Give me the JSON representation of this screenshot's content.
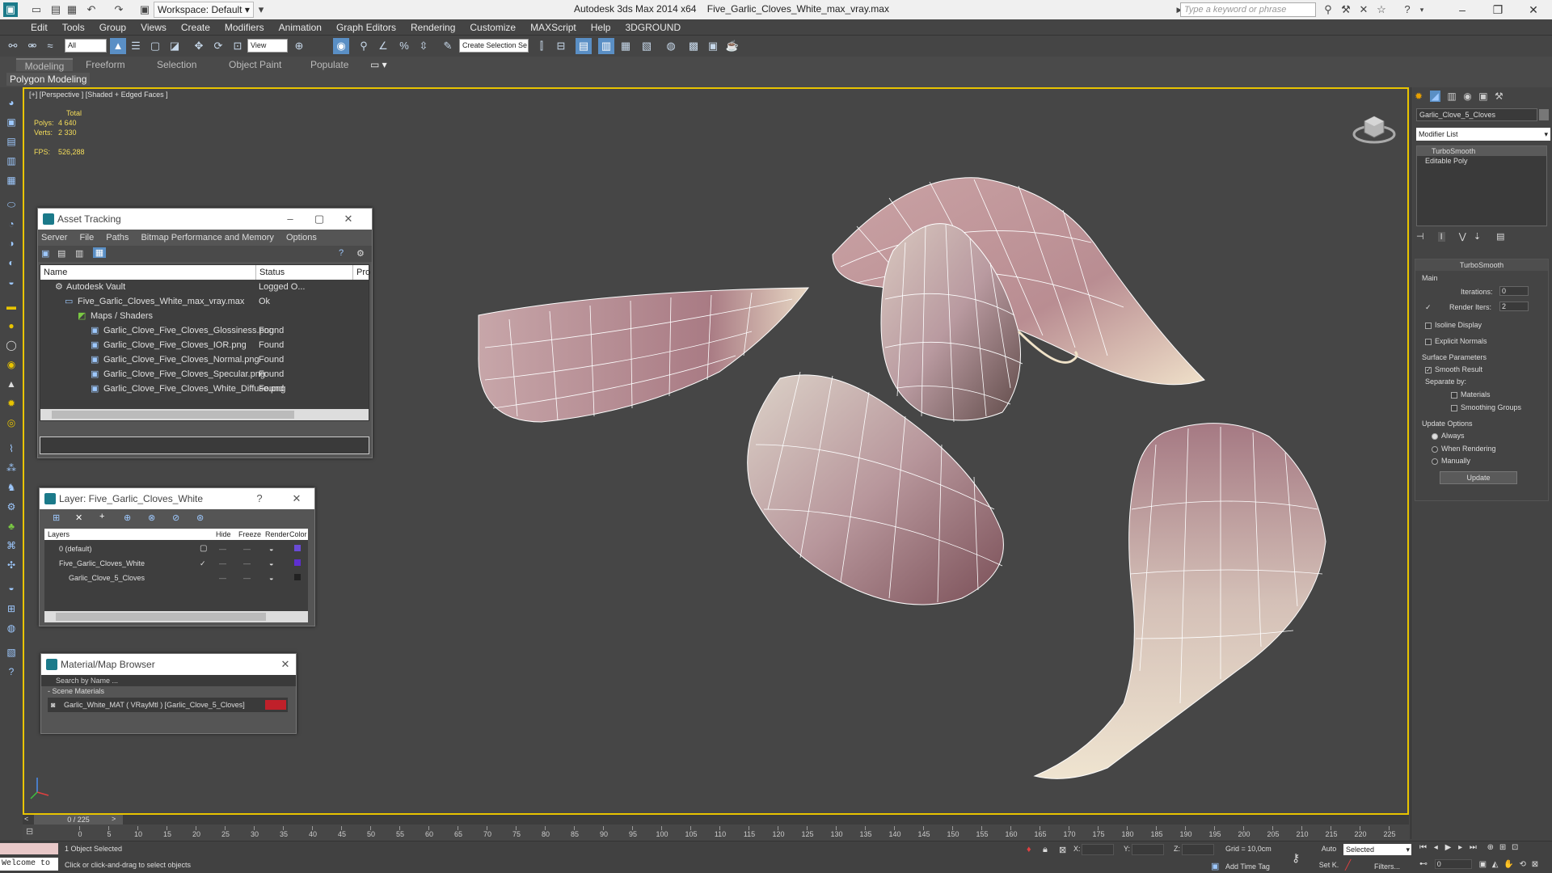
{
  "app": {
    "title": "Autodesk 3ds Max  2014 x64",
    "file": "Five_Garlic_Cloves_White_max_vray.max",
    "workspace": "Workspace: Default",
    "search_placeholder": "Type a keyword or phrase"
  },
  "menu": [
    "Edit",
    "Tools",
    "Group",
    "Views",
    "Create",
    "Modifiers",
    "Animation",
    "Graph Editors",
    "Rendering",
    "Customize",
    "MAXScript",
    "Help",
    "3DGROUND"
  ],
  "toolbar": {
    "filter": "All",
    "coord": "View",
    "named_selection": "Create Selection Se"
  },
  "ribbon": {
    "tabs": [
      "Modeling",
      "Freeform",
      "Selection",
      "Object Paint",
      "Populate"
    ],
    "subtab": "Polygon Modeling"
  },
  "viewport": {
    "label": "[+] [Perspective ] [Shaded + Edged Faces ]",
    "stats": {
      "total_label": "Total",
      "polys_label": "Polys:",
      "polys": "4 640",
      "verts_label": "Verts:",
      "verts": "2 330",
      "fps_label": "FPS:",
      "fps": "526,288"
    }
  },
  "asset_tracking": {
    "title": "Asset Tracking",
    "menu": [
      "Server",
      "File",
      "Paths",
      "Bitmap Performance and Memory",
      "Options"
    ],
    "columns": [
      "Name",
      "Status",
      "Pro"
    ],
    "rows": [
      {
        "name": "Autodesk Vault",
        "status": "Logged O..."
      },
      {
        "name": "Five_Garlic_Cloves_White_max_vray.max",
        "status": "Ok"
      },
      {
        "name": "Maps / Shaders",
        "status": ""
      },
      {
        "name": "Garlic_Clove_Five_Cloves_Glossiness.png",
        "status": "Found"
      },
      {
        "name": "Garlic_Clove_Five_Cloves_IOR.png",
        "status": "Found"
      },
      {
        "name": "Garlic_Clove_Five_Cloves_Normal.png",
        "status": "Found"
      },
      {
        "name": "Garlic_Clove_Five_Cloves_Specular.png",
        "status": "Found"
      },
      {
        "name": "Garlic_Clove_Five_Cloves_White_Diffuse.png",
        "status": "Found"
      }
    ]
  },
  "layer_window": {
    "title": "Layer: Five_Garlic_Cloves_White",
    "columns": [
      "Layers",
      "Hide",
      "Freeze",
      "Render",
      "Color"
    ],
    "rows": [
      {
        "name": "0 (default)",
        "color": "#6a4bd6"
      },
      {
        "name": "Five_Garlic_Cloves_White",
        "color": "#5e2fd0"
      },
      {
        "name": "Garlic_Clove_5_Cloves",
        "color": "#222222"
      }
    ]
  },
  "material_browser": {
    "title": "Material/Map Browser",
    "search_placeholder": "Search by Name ...",
    "section": "Scene Materials",
    "item": "Garlic_White_MAT ( VRayMtl ) [Garlic_Clove_5_Cloves]"
  },
  "command_panel": {
    "object_name": "Garlic_Clove_5_Cloves",
    "modifier_list": "Modifier List",
    "stack": [
      "TurboSmooth",
      "Editable Poly"
    ],
    "rollout_title": "TurboSmooth",
    "main_label": "Main",
    "iterations_label": "Iterations:",
    "iterations": "0",
    "render_iters_label": "Render Iters:",
    "render_iters": "2",
    "isoline": "Isoline Display",
    "explicit_normals": "Explicit Normals",
    "surface_params": "Surface Parameters",
    "smooth_result": "Smooth Result",
    "separate_by": "Separate by:",
    "materials": "Materials",
    "smoothing_groups": "Smoothing Groups",
    "update_options": "Update Options",
    "always": "Always",
    "when_rendering": "When Rendering",
    "manually": "Manually",
    "update_button": "Update"
  },
  "timeline": {
    "frame": "0 / 225",
    "ticks": [
      "0",
      "5",
      "10",
      "15",
      "20",
      "25",
      "30",
      "35",
      "40",
      "45",
      "50",
      "55",
      "60",
      "65",
      "70",
      "75",
      "80",
      "85",
      "90",
      "95",
      "100",
      "105",
      "110",
      "115",
      "120",
      "125",
      "130",
      "135",
      "140",
      "145",
      "150",
      "155",
      "160",
      "165",
      "170",
      "175",
      "180",
      "185",
      "190",
      "195",
      "200",
      "205",
      "210",
      "215",
      "220",
      "225"
    ]
  },
  "status": {
    "welcome": "Welcome to",
    "selected": "1 Object Selected",
    "hint": "Click or click-and-drag to select objects",
    "x_label": "X:",
    "y_label": "Y:",
    "z_label": "Z:",
    "grid": "Grid = 10,0cm",
    "add_time_tag": "Add Time Tag",
    "auto": "Auto",
    "set_k": "Set K.",
    "key_mode": "Selected",
    "filters": "Filters...",
    "frame_field": "0"
  }
}
